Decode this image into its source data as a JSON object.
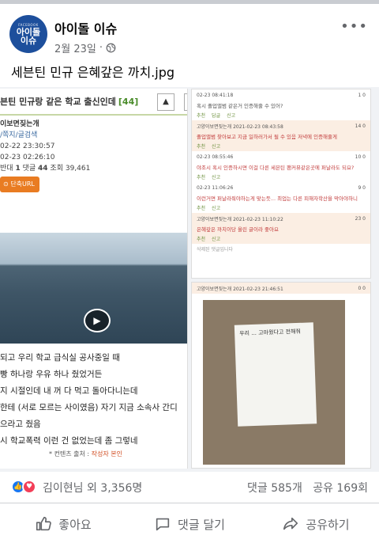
{
  "page": {
    "name": "아이돌 이슈",
    "avatar_small": "FACEBOOK",
    "avatar_big": "아이돌\n이슈",
    "date": "2월 23일",
    "privacy_icon": "globe-icon"
  },
  "post": {
    "text": "세븐틴 민규 은혜갚은 까치.jpg"
  },
  "left_image": {
    "title": "븐틴 민규랑 같은 학교 출신인데",
    "count": "[44]",
    "author": "이보면짖는개",
    "tags": "/쪽지/글검색",
    "date1": "02-22 23:30:57",
    "date2": "02-23 02:26:10",
    "stats_prefix": "반대",
    "stats_1": "1",
    "stats_mid": "댓글",
    "stats_44": "44",
    "stats_views": "조회 39,461",
    "url_btn": "단축URL",
    "lines": [
      "되고 우리 학교 급식실 공사중일 때",
      "빵 하나랑 우유 하나 줬었거든",
      "지 시절인데 내 꺼 다 먹고 돌아다니는데",
      "한테  (서로 모르는 사이였음)  자기 지금 소속사 간디",
      "으라고 줬음",
      "시 학교폭력 이런 건 없었는데 좀 그렇네"
    ],
    "source_label": "* 컨텐츠 출처 :",
    "source_value": "작성자 본인"
  },
  "comments": [
    {
      "nick": "",
      "date": "02-23 08:41:18",
      "score": "1 0",
      "text": "혹시 졸업앨범 같은거 인증해줄 수 있어?",
      "pink": false
    },
    {
      "nick": "고양이보면짖는개",
      "date": "2021-02-23 08:43:58",
      "score": "14 0",
      "text": "졸업앨범 찾아보고 지금 일하러가서 될 수 있음 저녁에 인증해줄게",
      "pink": true
    },
    {
      "nick": "",
      "date": "02-23 08:55:46",
      "score": "10 0",
      "text": "야조시 혹시 인증하시면 이걸 다른 세븐틴 팬커뮤같은곳에 퍼날라도 되요?",
      "pink": false
    },
    {
      "nick": "",
      "date": "02-23 11:06:26",
      "score": "9 0",
      "text": "이런거면 퍼날라줘야하는게 맞는듯... 최업는 다른 피해자학산을 막아야하니",
      "pink": false
    },
    {
      "nick": "고양이보면짖는개",
      "date": "2021-02-23 11:10:22",
      "score": "23 0",
      "text": "은혜갚은 까치이당 올린 글이라 좋아요",
      "pink": true
    }
  ],
  "comment_labels": {
    "recommend": "추천",
    "reply": "답글",
    "report": "신고",
    "deleted": "삭제된 댓글입니다"
  },
  "photo_comment": {
    "nick": "고양이보면짖는개",
    "date": "2021-02-23 21:46:51",
    "score": "0 0",
    "note": "우리 ... 고마웠다고 전해줘"
  },
  "reactions": {
    "summary": "김이현님 외 3,356명",
    "comments": "댓글 585개",
    "shares": "공유 169회"
  },
  "actions": {
    "like": "좋아요",
    "comment": "댓글 달기",
    "share": "공유하기"
  }
}
